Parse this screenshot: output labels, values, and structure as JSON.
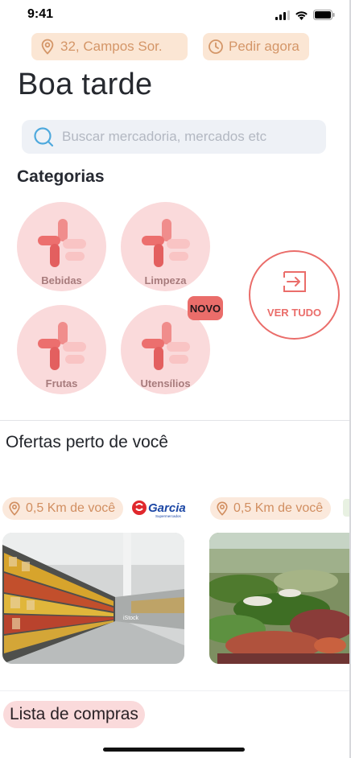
{
  "status_bar": {
    "time": "9:41"
  },
  "header": {
    "location": "32, Campos Sor.",
    "order_now": "Pedir agora",
    "greeting": "Boa tarde"
  },
  "search": {
    "placeholder": "Buscar mercadoria, mercados etc"
  },
  "categories": {
    "title": "Categorias",
    "items": [
      {
        "label": "Bebidas"
      },
      {
        "label": "Limpeza"
      },
      {
        "label": "Frutas"
      },
      {
        "label": "Utensílios"
      }
    ],
    "new_badge": "NOVO",
    "see_all": "VER TUDO"
  },
  "offers": {
    "title": "Ofertas perto de você",
    "stores": [
      {
        "distance": "0,5 Km de você",
        "brand": "Garcia",
        "brand_sub": "Supermercados"
      },
      {
        "distance": "0,5 Km de você"
      }
    ]
  },
  "shopping_list": {
    "label": "Lista de compras"
  },
  "colors": {
    "accent": "#ea6d6a",
    "chip_bg": "#fbe6d4",
    "chip_text": "#d49668",
    "category_bg": "#fadadb"
  }
}
